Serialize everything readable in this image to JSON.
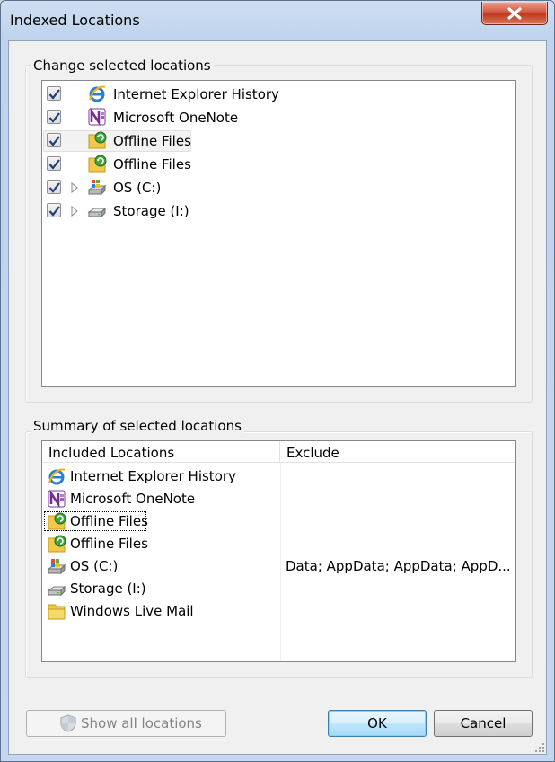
{
  "window": {
    "title": "Indexed Locations",
    "close_icon": "close-icon"
  },
  "change_group": {
    "label": "Change selected locations",
    "items": [
      {
        "label": "Internet Explorer History",
        "checked": true,
        "expandable": false,
        "icon": "ie-icon"
      },
      {
        "label": "Microsoft OneNote",
        "checked": true,
        "expandable": false,
        "icon": "onenote-icon"
      },
      {
        "label": "Offline Files",
        "checked": true,
        "expandable": false,
        "icon": "offline-files-icon",
        "selected": true
      },
      {
        "label": "Offline Files",
        "checked": true,
        "expandable": false,
        "icon": "offline-files-icon"
      },
      {
        "label": "OS (C:)",
        "checked": true,
        "expandable": true,
        "icon": "windows-drive-icon"
      },
      {
        "label": "Storage (I:)",
        "checked": true,
        "expandable": true,
        "icon": "drive-icon"
      }
    ]
  },
  "summary_group": {
    "label": "Summary of selected locations",
    "columns": [
      "Included Locations",
      "Exclude"
    ],
    "rows": [
      {
        "location": "Internet Explorer History",
        "exclude": "",
        "icon": "ie-icon"
      },
      {
        "location": "Microsoft OneNote",
        "exclude": "",
        "icon": "onenote-icon"
      },
      {
        "location": "Offline Files",
        "exclude": "",
        "icon": "offline-files-icon",
        "focused": true
      },
      {
        "location": "Offline Files",
        "exclude": "",
        "icon": "offline-files-icon"
      },
      {
        "location": "OS (C:)",
        "exclude": "Data; AppData; AppData; AppD...",
        "icon": "windows-drive-icon"
      },
      {
        "location": "Storage (I:)",
        "exclude": "",
        "icon": "drive-icon"
      },
      {
        "location": "Windows Live Mail",
        "exclude": "",
        "icon": "folder-icon"
      }
    ]
  },
  "buttons": {
    "show_all": "Show all locations",
    "show_all_icon": "uac-shield-icon",
    "ok": "OK",
    "cancel": "Cancel"
  },
  "colors": {
    "title_bar": "#bfd4ec",
    "close_button": "#c1381d",
    "default_button_border": "#3c7fb1",
    "dialog_background": "#f0f0f0"
  }
}
